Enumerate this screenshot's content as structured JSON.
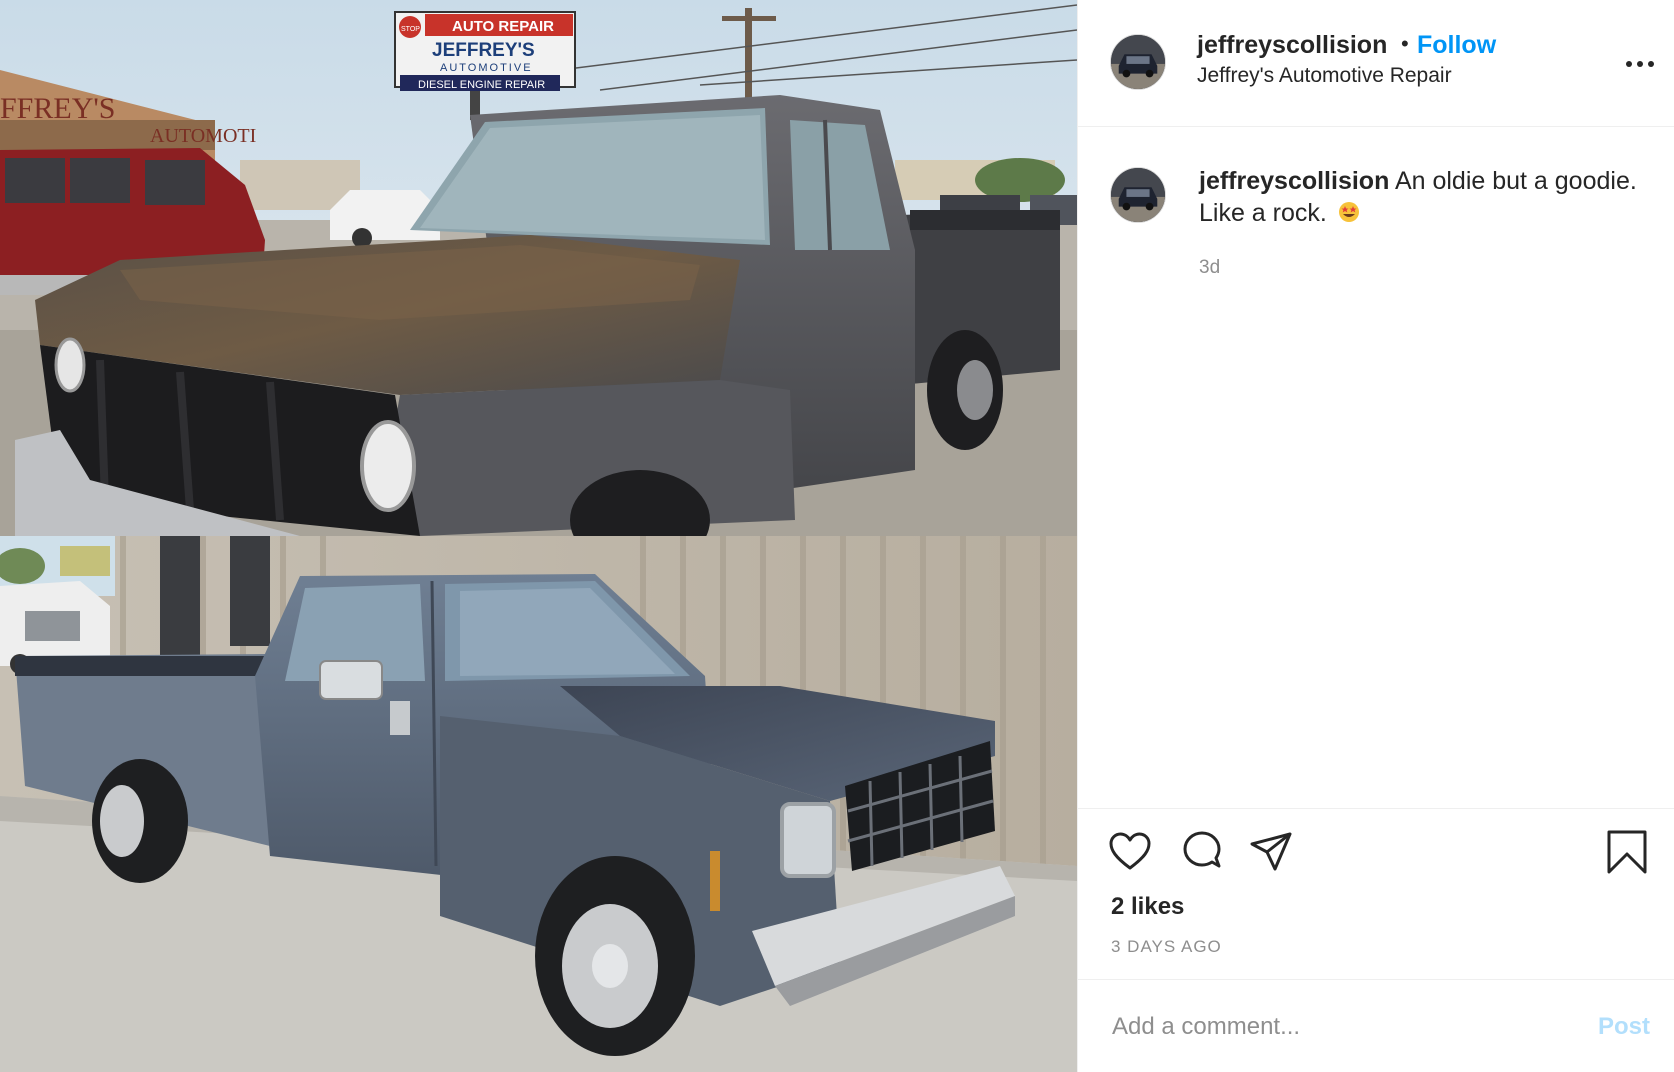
{
  "post": {
    "author": {
      "username": "jeffreyscollision",
      "separator": "•",
      "follow_label": "Follow",
      "subtitle": "Jeffrey's Automotive Repair"
    },
    "more_icon": "ellipsis-icon",
    "photo": {
      "sign_line1": "AUTO REPAIR",
      "sign_line2": "JEFFREY'S",
      "sign_line3": "AUTOMOTIVE",
      "sign_line4": "DIESEL ENGINE REPAIR",
      "sign_stop": "STOP"
    },
    "caption": {
      "username": "jeffreyscollision",
      "text": "An oldie but a goodie. Like a rock.",
      "emoji": "star-struck-emoji-icon",
      "age": "3d"
    },
    "actions": {
      "icons": [
        "heart-icon",
        "comment-icon",
        "share-icon",
        "bookmark-icon"
      ],
      "likes": "2 likes",
      "timestamp": "3 DAYS AGO"
    },
    "comment_form": {
      "placeholder": "Add a comment...",
      "post_label": "Post"
    },
    "colors": {
      "accent": "#0095f6",
      "post_disabled": "#b2dffc",
      "muted": "#8e8e8e",
      "border": "#efefef"
    }
  }
}
